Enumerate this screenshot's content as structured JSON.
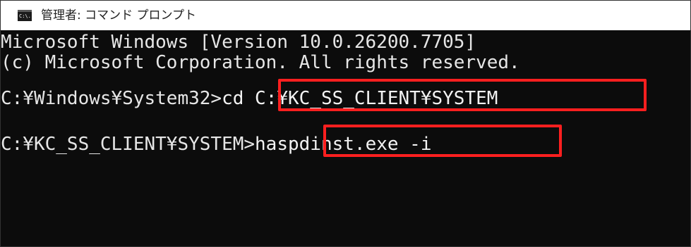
{
  "window": {
    "title": "管理者: コマンド プロンプト",
    "icon_name": "cmd-icon",
    "icon_label": "C:\\."
  },
  "console": {
    "lines": [
      {
        "text": "Microsoft Windows [Version 10.0.26200.7705]"
      },
      {
        "text": "(c) Microsoft Corporation. All rights reserved."
      }
    ],
    "commands": [
      {
        "prompt": "C:¥Windows¥System32>",
        "input": "cd C:¥KC_SS_CLIENT¥SYSTEM"
      },
      {
        "prompt": "C:¥KC_SS_CLIENT¥SYSTEM>",
        "input": "haspdinst.exe -i"
      }
    ]
  },
  "colors": {
    "background": "#0c0c0c",
    "text": "#e6e6e6",
    "highlight": "#ff1f1f",
    "titlebar": "#ffffff"
  }
}
